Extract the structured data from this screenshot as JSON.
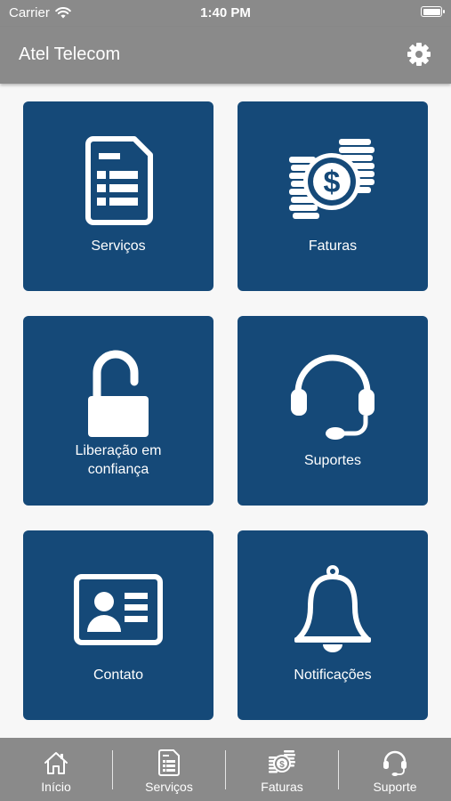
{
  "status_bar": {
    "carrier": "Carrier",
    "time": "1:40 PM"
  },
  "header": {
    "title": "Atel Telecom",
    "settings_icon": "gear-icon"
  },
  "tiles": [
    {
      "label": "Serviços",
      "icon": "document-icon"
    },
    {
      "label": "Faturas",
      "icon": "coins-icon"
    },
    {
      "label": "Liberação em\nconfiança",
      "icon": "unlock-icon"
    },
    {
      "label": "Suportes",
      "icon": "headset-icon"
    },
    {
      "label": "Contato",
      "icon": "contact-card-icon"
    },
    {
      "label": "Notificações",
      "icon": "bell-icon"
    }
  ],
  "tab_bar": [
    {
      "label": "Início",
      "icon": "home-icon"
    },
    {
      "label": "Serviços",
      "icon": "document-icon"
    },
    {
      "label": "Faturas",
      "icon": "coins-icon"
    },
    {
      "label": "Suporte",
      "icon": "headset-icon"
    }
  ],
  "colors": {
    "bar": "#8a8a8a",
    "tile": "#154978",
    "background": "#f7f7f7"
  }
}
